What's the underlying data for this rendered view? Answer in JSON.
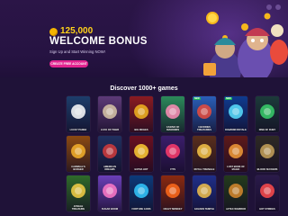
{
  "hero": {
    "bonus_amount": "125,000",
    "headline": "WELCOME BONUS",
    "subline": "Sign Up and Start Winning NOW!",
    "cta_label": "CREATE FREE ACCOUNT"
  },
  "games_section": {
    "title": "Discover 1000+ games"
  },
  "games": [
    {
      "name": "LUCKY PANDA",
      "bg": "#1d3e6b",
      "accent": "#ffffff",
      "new": false
    },
    {
      "name": "LUCK OF TIGER",
      "bg": "#5d3a78",
      "accent": "#d9c7a8",
      "new": false
    },
    {
      "name": "BIG RICHES",
      "bg": "#8a1b21",
      "accent": "#f2b51f",
      "new": false
    },
    {
      "name": "CASINO OF DIAMONDS",
      "bg": "#2c8a5a",
      "accent": "#ff8db6",
      "new": false
    },
    {
      "name": "3 BUDDIES TREASURES",
      "bg": "#2a5fb8",
      "accent": "#e94b3c",
      "new": true
    },
    {
      "name": "DIAMOND ROYALE",
      "bg": "#0f3b8f",
      "accent": "#5ae1ff",
      "new": true
    },
    {
      "name": "RISE OF RUBY",
      "bg": "#1c3a3a",
      "accent": "#3ad06b",
      "new": false
    },
    {
      "name": "CARNIVAL'S BURGER",
      "bg": "#8b4a12",
      "accent": "#f6b12c",
      "new": false
    },
    {
      "name": "AMERICAN DREAMS",
      "bg": "#20305f",
      "accent": "#d23b3b",
      "new": false
    },
    {
      "name": "EXTRA HOT",
      "bg": "#6b1020",
      "accent": "#ffcc33",
      "new": false
    },
    {
      "name": "777S",
      "bg": "#3b1e6b",
      "accent": "#ff3b6b",
      "new": false
    },
    {
      "name": "ROYAL TRIANGLE",
      "bg": "#5a2f1c",
      "accent": "#f7c548",
      "new": false
    },
    {
      "name": "LOST BOOK OF MAGIC",
      "bg": "#5e1a1a",
      "accent": "#f29c38",
      "new": false
    },
    {
      "name": "BLOOD SUCKERS",
      "bg": "#2e2a24",
      "accent": "#c8a35a",
      "new": false
    },
    {
      "name": "JUNGLE TREASURE",
      "bg": "#2f6b2a",
      "accent": "#f7d046",
      "new": false
    },
    {
      "name": "SUGAR BOOM",
      "bg": "#6b3fb8",
      "accent": "#ff7ac8",
      "new": false
    },
    {
      "name": "FORTUNE GODS",
      "bg": "#0c3a7a",
      "accent": "#33c9ff",
      "new": false
    },
    {
      "name": "CRAZY MONKEY",
      "bg": "#8a2a10",
      "accent": "#ff6a1a",
      "new": false
    },
    {
      "name": "GOLDEN TEMPLE",
      "bg": "#1f2f8a",
      "accent": "#f2c14b",
      "new": false
    },
    {
      "name": "AZTEC WARRIOR",
      "bg": "#243b1c",
      "accent": "#d88a2e",
      "new": false
    },
    {
      "name": "HOT STRIKES",
      "bg": "#2a1a4a",
      "accent": "#ff4b4b",
      "new": false
    }
  ]
}
